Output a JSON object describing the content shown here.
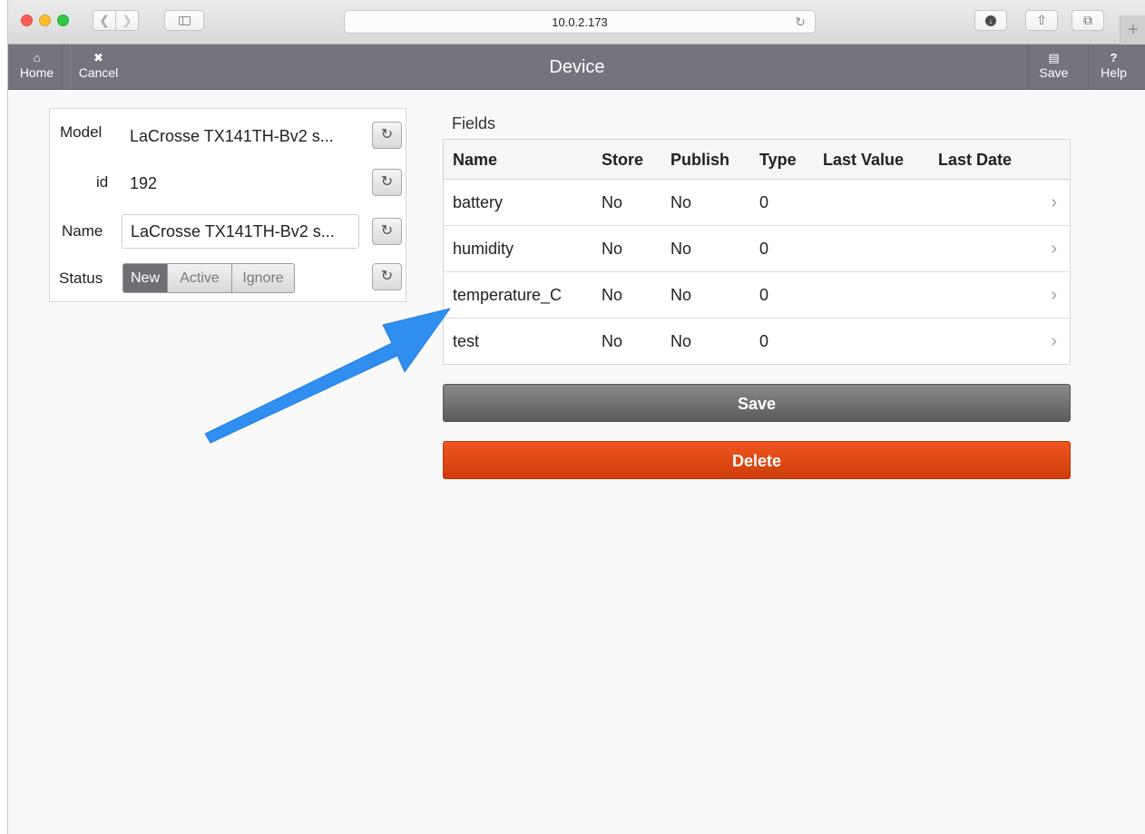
{
  "browser": {
    "url": "10.0.2.173"
  },
  "header": {
    "title": "Device",
    "home_label": "Home",
    "cancel_label": "Cancel",
    "save_label": "Save",
    "help_label": "Help"
  },
  "device": {
    "model_label": "Model",
    "model_value": "LaCrosse TX141TH-Bv2 s...",
    "id_label": "id",
    "id_value": "192",
    "name_label": "Name",
    "name_value": "LaCrosse TX141TH-Bv2 s...",
    "status_label": "Status",
    "status_options": [
      "New",
      "Active",
      "Ignore"
    ],
    "status_selected": "New"
  },
  "fields": {
    "title": "Fields",
    "columns": [
      "Name",
      "Store",
      "Publish",
      "Type",
      "Last Value",
      "Last Date"
    ],
    "rows": [
      {
        "name": "battery",
        "store": "No",
        "publish": "No",
        "type": "0",
        "last_value": "",
        "last_date": ""
      },
      {
        "name": "humidity",
        "store": "No",
        "publish": "No",
        "type": "0",
        "last_value": "",
        "last_date": ""
      },
      {
        "name": "temperature_C",
        "store": "No",
        "publish": "No",
        "type": "0",
        "last_value": "",
        "last_date": ""
      },
      {
        "name": "test",
        "store": "No",
        "publish": "No",
        "type": "0",
        "last_value": "",
        "last_date": ""
      }
    ]
  },
  "actions": {
    "save_label": "Save",
    "delete_label": "Delete"
  },
  "colors": {
    "header_bg": "#74747e",
    "delete": "#e04a13",
    "annotation_arrow": "#2f8ef0"
  }
}
